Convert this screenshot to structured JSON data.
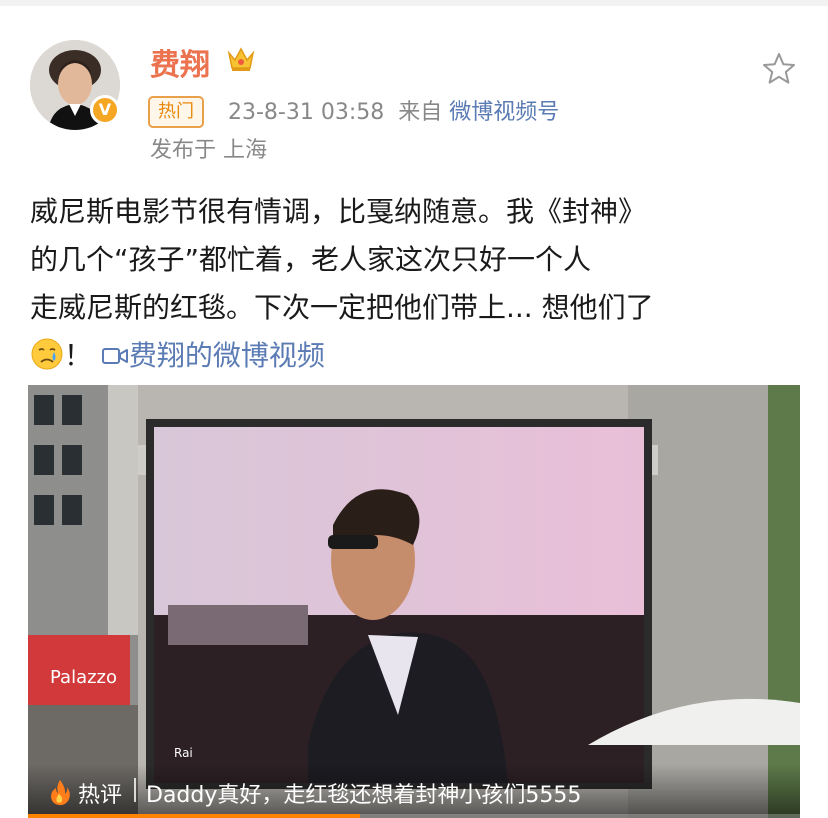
{
  "post": {
    "author": "费翔",
    "verified_badge": "V",
    "hot_tag": "热门",
    "timestamp": "23-8-31 03:58",
    "from_prefix": "来自",
    "source": "微博视频号",
    "location": "发布于 上海",
    "text_lines": [
      "威尼斯电影节很有情调，比戛纳随意。我《封神》",
      "的几个“孩子”都忙着，老人家这次只好一个人",
      "走威尼斯的红毯。下次一定把他们带上... 想他们了"
    ],
    "text_end": "！",
    "video_link": "费翔的微博视频",
    "icons": [
      "crown-icon",
      "star-icon",
      "crying-emoji",
      "video-camera-icon",
      "flame-icon"
    ]
  },
  "video": {
    "hot_comment_label": "热评",
    "hot_comment": "Daddy真好，走红毯还想着封神小孩们5555",
    "signage": "Palazzo",
    "screen_logo": "Rai",
    "progress": 0.43
  },
  "colors": {
    "name": "#eb7350",
    "link": "#5b7bb4",
    "hot_tag": "#e8870c",
    "progress": "#ff8200"
  }
}
